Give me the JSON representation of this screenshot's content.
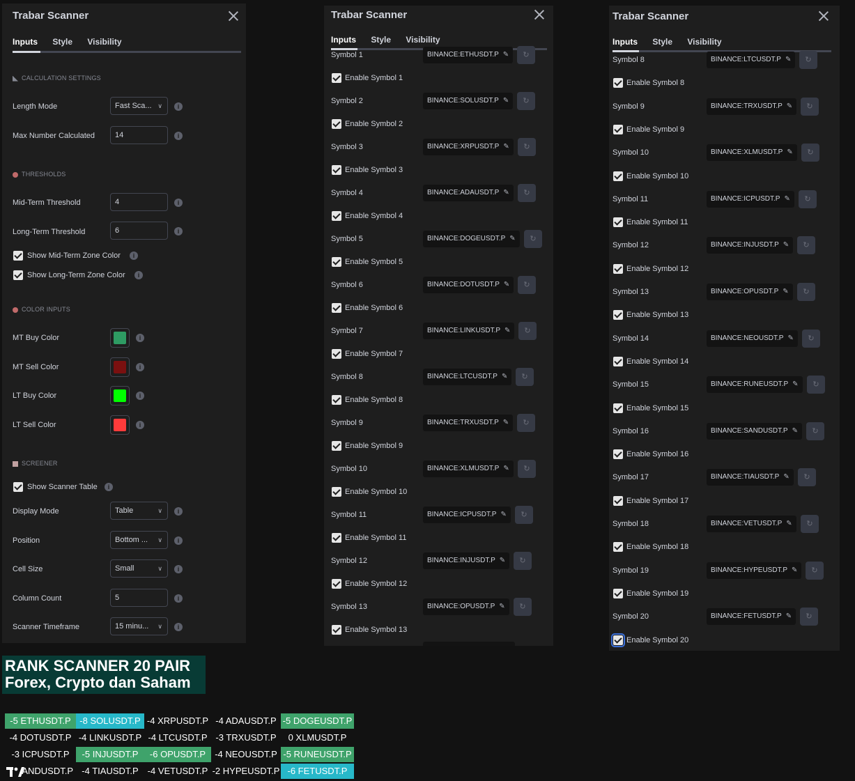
{
  "dialog": {
    "title": "Trabar Scanner",
    "tabs": [
      "Inputs",
      "Style",
      "Visibility"
    ]
  },
  "left": {
    "sections": {
      "calc": "CALCULATION SETTINGS",
      "thresholds": "THRESHOLDS",
      "color": "COLOR INPUTS",
      "screener": "SCREENER"
    },
    "length_mode": {
      "label": "Length Mode",
      "value": "Fast Sca..."
    },
    "max_number": {
      "label": "Max Number Calculated",
      "value": "14"
    },
    "mid_threshold": {
      "label": "Mid-Term Threshold",
      "value": "4"
    },
    "long_threshold": {
      "label": "Long-Term Threshold",
      "value": "6"
    },
    "show_mid": "Show Mid-Term Zone Color",
    "show_long": "Show Long-Term Zone Color",
    "mt_buy": {
      "label": "MT Buy Color",
      "color": "#2e9b63"
    },
    "mt_sell": {
      "label": "MT Sell Color",
      "color": "#7a1010"
    },
    "lt_buy": {
      "label": "LT Buy Color",
      "color": "#00ff00"
    },
    "lt_sell": {
      "label": "LT Sell Color",
      "color": "#ff3b3b"
    },
    "show_table": "Show Scanner Table",
    "display_mode": {
      "label": "Display Mode",
      "value": "Table"
    },
    "position": {
      "label": "Position",
      "value": "Bottom ..."
    },
    "cell_size": {
      "label": "Cell Size",
      "value": "Small"
    },
    "column_count": {
      "label": "Column Count",
      "value": "5"
    },
    "timeframe": {
      "label": "Scanner Timeframe",
      "value": "15 minu..."
    }
  },
  "middle": {
    "rows": [
      {
        "label": "Symbol 1",
        "symbol": "BINANCE:ETHUSDT.P",
        "enable": "Enable Symbol 1"
      },
      {
        "label": "Symbol 2",
        "symbol": "BINANCE:SOLUSDT.P",
        "enable": "Enable Symbol 2"
      },
      {
        "label": "Symbol 3",
        "symbol": "BINANCE:XRPUSDT.P",
        "enable": "Enable Symbol 3"
      },
      {
        "label": "Symbol 4",
        "symbol": "BINANCE:ADAUSDT.P",
        "enable": "Enable Symbol 4"
      },
      {
        "label": "Symbol 5",
        "symbol": "BINANCE:DOGEUSDT.P",
        "enable": "Enable Symbol 5"
      },
      {
        "label": "Symbol 6",
        "symbol": "BINANCE:DOTUSDT.P",
        "enable": "Enable Symbol 6"
      },
      {
        "label": "Symbol 7",
        "symbol": "BINANCE:LINKUSDT.P",
        "enable": "Enable Symbol 7"
      },
      {
        "label": "Symbol 8",
        "symbol": "BINANCE:LTCUSDT.P",
        "enable": "Enable Symbol 8"
      },
      {
        "label": "Symbol 9",
        "symbol": "BINANCE:TRXUSDT.P",
        "enable": "Enable Symbol 9"
      },
      {
        "label": "Symbol 10",
        "symbol": "BINANCE:XLMUSDT.P",
        "enable": "Enable Symbol 10"
      },
      {
        "label": "Symbol 11",
        "symbol": "BINANCE:ICPUSDT.P",
        "enable": "Enable Symbol 11"
      },
      {
        "label": "Symbol 12",
        "symbol": "BINANCE:INJUSDT.P",
        "enable": "Enable Symbol 12"
      },
      {
        "label": "Symbol 13",
        "symbol": "BINANCE:OPUSDT.P",
        "enable": "Enable Symbol 13"
      }
    ]
  },
  "right": {
    "rows": [
      {
        "label": "Symbol 8",
        "symbol": "BINANCE:LTCUSDT.P",
        "enable": "Enable Symbol 8"
      },
      {
        "label": "Symbol 9",
        "symbol": "BINANCE:TRXUSDT.P",
        "enable": "Enable Symbol 9"
      },
      {
        "label": "Symbol 10",
        "symbol": "BINANCE:XLMUSDT.P",
        "enable": "Enable Symbol 10"
      },
      {
        "label": "Symbol 11",
        "symbol": "BINANCE:ICPUSDT.P",
        "enable": "Enable Symbol 11"
      },
      {
        "label": "Symbol 12",
        "symbol": "BINANCE:INJUSDT.P",
        "enable": "Enable Symbol 12"
      },
      {
        "label": "Symbol 13",
        "symbol": "BINANCE:OPUSDT.P",
        "enable": "Enable Symbol 13"
      },
      {
        "label": "Symbol 14",
        "symbol": "BINANCE:NEOUSDT.P",
        "enable": "Enable Symbol 14"
      },
      {
        "label": "Symbol 15",
        "symbol": "BINANCE:RUNEUSDT.P",
        "enable": "Enable Symbol 15"
      },
      {
        "label": "Symbol 16",
        "symbol": "BINANCE:SANDUSDT.P",
        "enable": "Enable Symbol 16"
      },
      {
        "label": "Symbol 17",
        "symbol": "BINANCE:TIAUSDT.P",
        "enable": "Enable Symbol 17"
      },
      {
        "label": "Symbol 18",
        "symbol": "BINANCE:VETUSDT.P",
        "enable": "Enable Symbol 18"
      },
      {
        "label": "Symbol 19",
        "symbol": "BINANCE:HYPEUSDT.P",
        "enable": "Enable Symbol 19"
      },
      {
        "label": "Symbol 20",
        "symbol": "BINANCE:FETUSDT.P",
        "enable": "Enable Symbol 20"
      }
    ]
  },
  "banner": {
    "line1": "RANK SCANNER 20 PAIR",
    "line2": "Forex, Crypto dan Saham"
  },
  "table": {
    "colors": {
      "green": "#3fa36b",
      "cyan": "#27b8c9",
      "none": "transparent"
    },
    "rows": [
      [
        {
          "text": "-5 ETHUSDT.P",
          "bg": "green"
        },
        {
          "text": "-8 SOLUSDT.P",
          "bg": "cyan"
        },
        {
          "text": "-4 XRPUSDT.P",
          "bg": "none"
        },
        {
          "text": "-4 ADAUSDT.P",
          "bg": "none"
        },
        {
          "text": "-5 DOGEUSDT.P",
          "bg": "green"
        }
      ],
      [
        {
          "text": "-4 DOTUSDT.P",
          "bg": "none"
        },
        {
          "text": "-4 LINKUSDT.P",
          "bg": "none"
        },
        {
          "text": "-4 LTCUSDT.P",
          "bg": "none"
        },
        {
          "text": "-3 TRXUSDT.P",
          "bg": "none"
        },
        {
          "text": "0 XLMUSDT.P",
          "bg": "none"
        }
      ],
      [
        {
          "text": "-3 ICPUSDT.P",
          "bg": "none"
        },
        {
          "text": "-5 INJUSDT.P",
          "bg": "green"
        },
        {
          "text": "-6 OPUSDT.P",
          "bg": "green"
        },
        {
          "text": "-4 NEOUSDT.P",
          "bg": "none"
        },
        {
          "text": "-5 RUNEUSDT.P",
          "bg": "green"
        }
      ],
      [
        {
          "text": "ANDUSDT.P",
          "bg": "none"
        },
        {
          "text": "-4 TIAUSDT.P",
          "bg": "none"
        },
        {
          "text": "-4 VETUSDT.P",
          "bg": "none"
        },
        {
          "text": "-2 HYPEUSDT.P",
          "bg": "none"
        },
        {
          "text": "-6 FETUSDT.P",
          "bg": "cyan"
        }
      ]
    ]
  },
  "logo": "TV"
}
